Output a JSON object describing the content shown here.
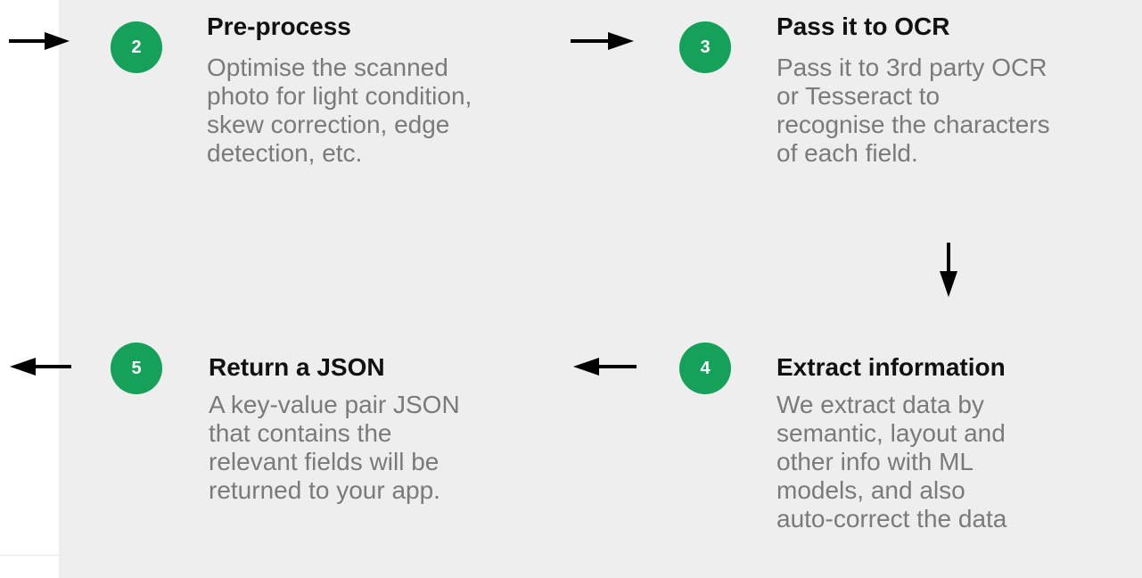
{
  "steps": [
    {
      "number": "2",
      "title": "Pre-process",
      "desc_lines": [
        "Optimise the scanned",
        "photo for light condition,",
        "skew correction, edge",
        "detection, etc."
      ]
    },
    {
      "number": "3",
      "title": "Pass it to OCR",
      "desc_lines": [
        "Pass it to 3rd party OCR",
        "or Tesseract to",
        "recognise the characters",
        "of each field."
      ]
    },
    {
      "number": "4",
      "title": "Extract information",
      "desc_lines": [
        "We extract data by",
        "semantic, layout and",
        "other info with ML",
        "models, and also",
        "auto-correct the data"
      ]
    },
    {
      "number": "5",
      "title": "Return a JSON",
      "desc_lines": [
        "A key-value pair JSON",
        "that contains the",
        "relevant fields will be",
        "returned to your app."
      ]
    }
  ],
  "colors": {
    "badge": "#16a15b",
    "panel": "#eeeeee",
    "title": "#111111",
    "desc": "#7a7a7a",
    "arrow": "#000000"
  },
  "arrows": [
    "arrow-right-icon",
    "arrow-right-icon",
    "arrow-down-icon",
    "arrow-left-icon",
    "arrow-left-icon"
  ]
}
